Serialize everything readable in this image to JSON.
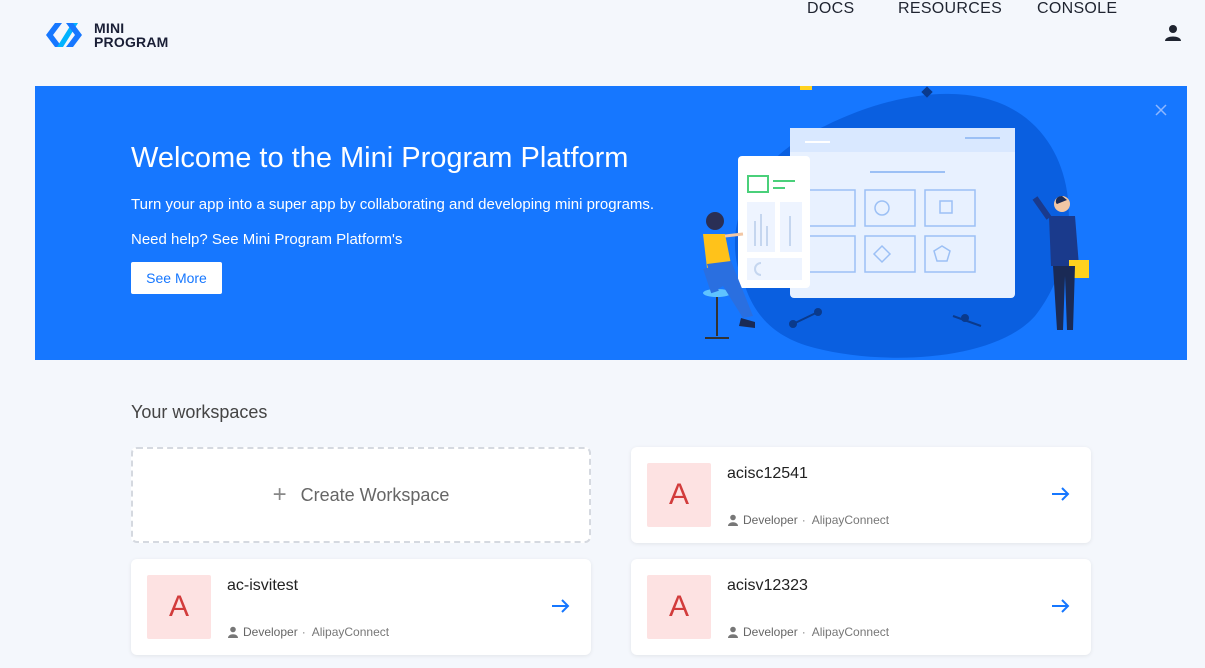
{
  "header": {
    "logo_line1": "MINI",
    "logo_line2": "PROGRAM",
    "nav": [
      "DOCS",
      "RESOURCES",
      "CONSOLE"
    ]
  },
  "banner": {
    "title": "Welcome to the Mini Program Platform",
    "subtitle": "Turn your app into a super app by collaborating and developing mini programs.",
    "help": "Need help? See Mini Program Platform's",
    "button": "See More"
  },
  "workspaces": {
    "title": "Your workspaces",
    "create_label": "Create Workspace",
    "items": [
      {
        "avatar": "A",
        "name": "acisc12541",
        "role": "Developer",
        "org": "AlipayConnect"
      },
      {
        "avatar": "A",
        "name": "ac-isvitest",
        "role": "Developer",
        "org": "AlipayConnect"
      },
      {
        "avatar": "A",
        "name": "acisv12323",
        "role": "Developer",
        "org": "AlipayConnect"
      }
    ]
  },
  "colors": {
    "brand": "#1677ff",
    "avatar_bg": "#fde2e2",
    "avatar_text": "#d23c3c"
  }
}
